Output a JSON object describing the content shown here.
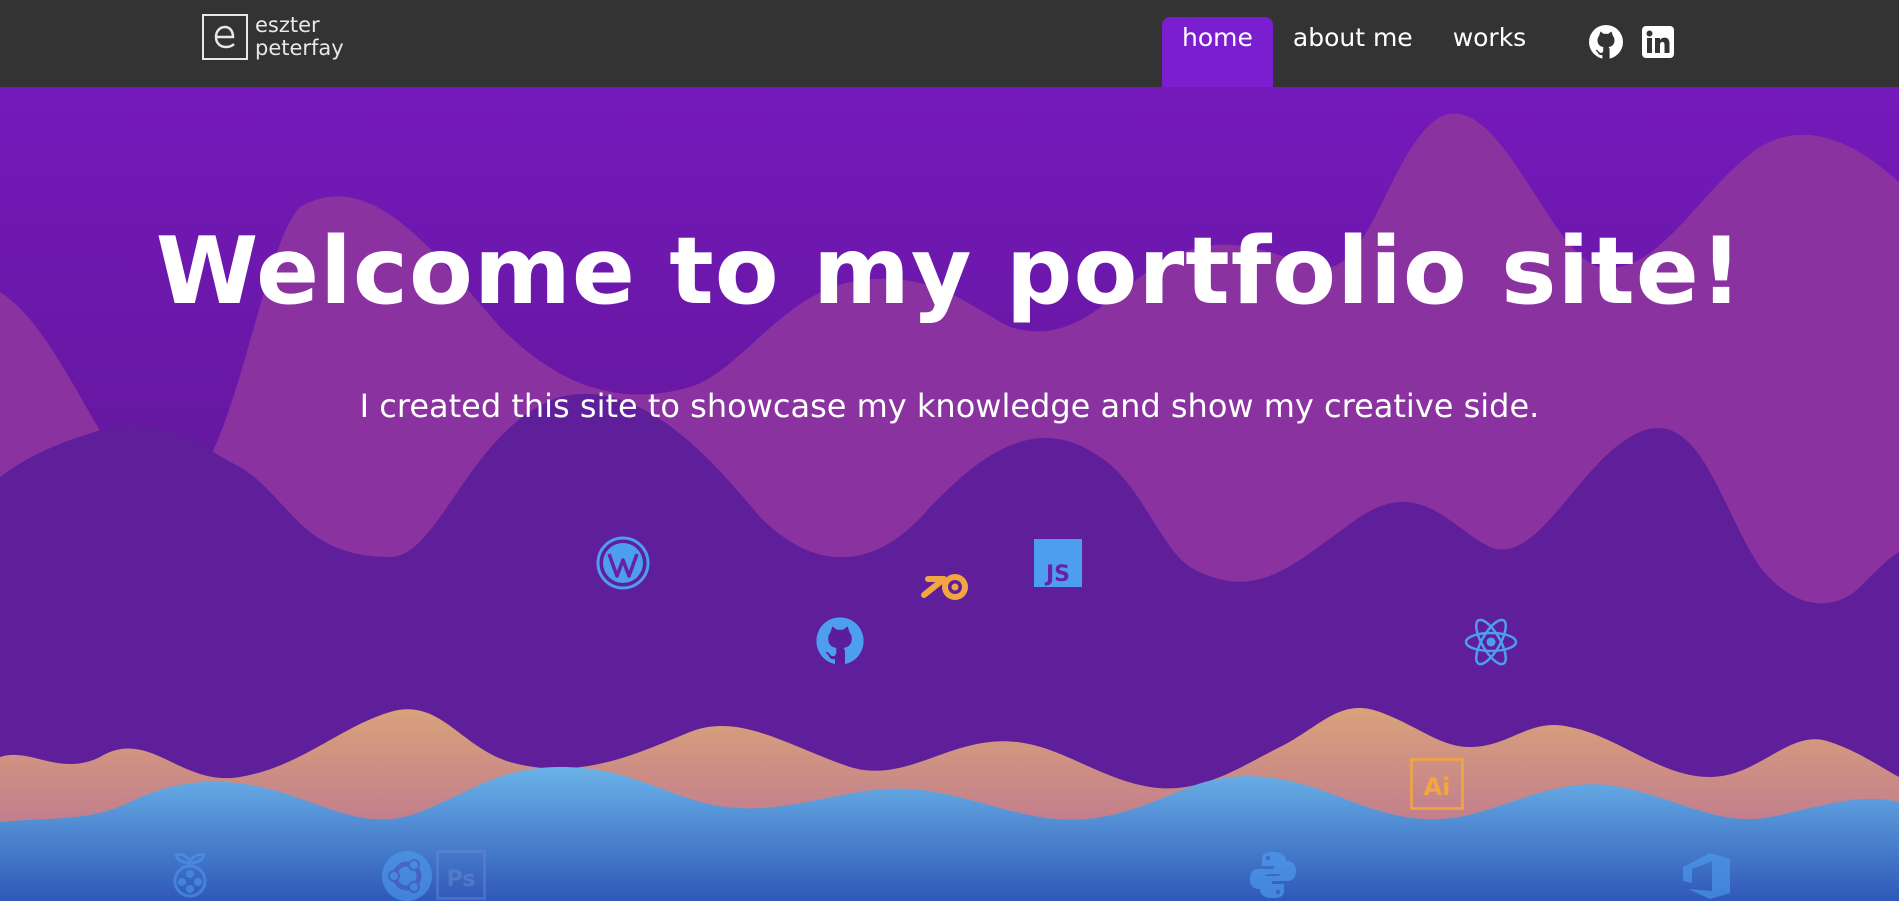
{
  "brand": {
    "line1": "eszter",
    "line2": "peterfay"
  },
  "nav": {
    "items": [
      {
        "label": "home",
        "active": true
      },
      {
        "label": "about me",
        "active": false
      },
      {
        "label": "works",
        "active": false
      }
    ],
    "social": [
      "github-icon",
      "linkedin-icon"
    ]
  },
  "hero": {
    "title": "Welcome to my portfolio site!",
    "subtitle": "I created this site to showcase my knowledge and show my creative side."
  },
  "tech_icons": [
    "wordpress-icon",
    "github-icon",
    "blender-icon",
    "javascript-icon",
    "react-icon",
    "illustrator-icon",
    "raspberry-pi-icon",
    "ubuntu-icon",
    "photoshop-icon",
    "python-icon",
    "azure-devops-icon"
  ],
  "tech_labels": {
    "javascript": "JS",
    "illustrator": "Ai",
    "photoshop": "Ps"
  },
  "colors": {
    "navbar": "#333333",
    "accent": "#7b1ecf",
    "bg_top": "#7419b9",
    "wave_mauve": "#88329b",
    "wave_deep": "#5d1f99",
    "wave_peach": "#d7a07e",
    "wave_blue": "#66abe4",
    "icon_blue": "#4e9ef0",
    "icon_orange": "#f2a641"
  }
}
